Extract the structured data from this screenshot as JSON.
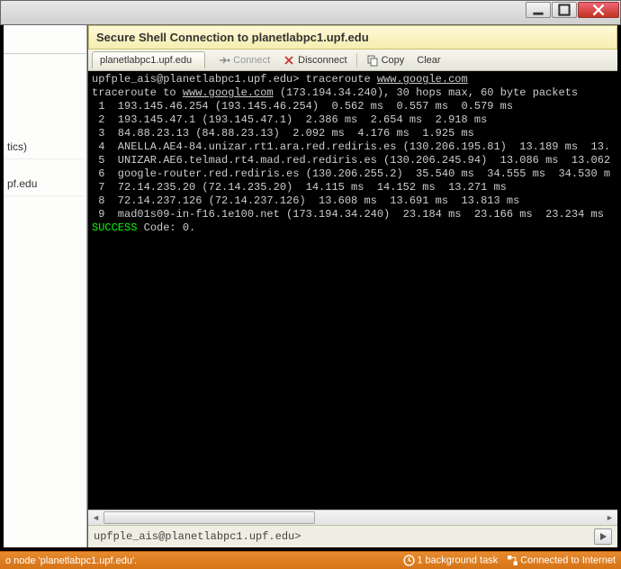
{
  "window": {
    "minimize_icon": "minimize",
    "maximize_icon": "maximize",
    "close_icon": "close"
  },
  "left": {
    "item1": "tics)",
    "item2": "pf.edu"
  },
  "ssh": {
    "title": "Secure Shell Connection to planetlabpc1.upf.edu",
    "tab": "planetlabpc1.upf.edu",
    "btn_connect": "Connect",
    "btn_disconnect": "Disconnect",
    "btn_copy": "Copy",
    "btn_clear": "Clear",
    "prompt_text": "upfple_ais@planetlabpc1.upf.edu> ",
    "prompt_value": ""
  },
  "terminal": {
    "line0_a": "upfple_ais@planetlabpc1.upf.edu> traceroute ",
    "line0_b": "www.google.com",
    "line1_a": "traceroute to ",
    "line1_b": "www.google.com",
    "line1_c": " (173.194.34.240), 30 hops max, 60 byte packets",
    "line2": " 1  193.145.46.254 (193.145.46.254)  0.562 ms  0.557 ms  0.579 ms",
    "line3": " 2  193.145.47.1 (193.145.47.1)  2.386 ms  2.654 ms  2.918 ms",
    "line4": " 3  84.88.23.13 (84.88.23.13)  2.092 ms  4.176 ms  1.925 ms",
    "line5": " 4  ANELLA.AE4-84.unizar.rt1.ara.red.rediris.es (130.206.195.81)  13.189 ms  13.",
    "line6": " 5  UNIZAR.AE6.telmad.rt4.mad.red.rediris.es (130.206.245.94)  13.086 ms  13.062",
    "line7": " 6  google-router.red.rediris.es (130.206.255.2)  35.540 ms  34.555 ms  34.530 m",
    "line8": " 7  72.14.235.20 (72.14.235.20)  14.115 ms  14.152 ms  13.271 ms",
    "line9": " 8  72.14.237.126 (72.14.237.126)  13.608 ms  13.691 ms  13.813 ms",
    "line10": " 9  mad01s09-in-f16.1e100.net (173.194.34.240)  23.184 ms  23.166 ms  23.234 ms",
    "line11_a": "SUCCESS",
    "line11_b": " Code: 0."
  },
  "status": {
    "left": "o node 'planetlabpc1.upf.edu'.",
    "task": "1 background task",
    "net": "Connected to Internet"
  }
}
